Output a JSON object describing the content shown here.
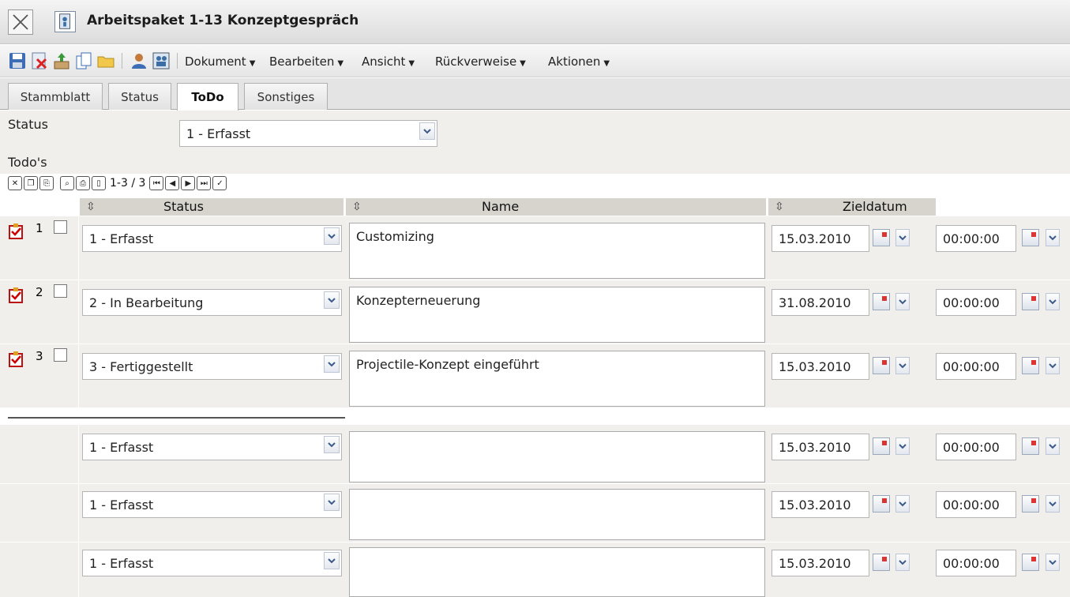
{
  "window": {
    "title": "Arbeitspaket 1-13 Konzeptgespräch"
  },
  "toolbar": {
    "icons": [
      "save-icon",
      "delete-icon",
      "export-icon",
      "copy-icon",
      "folder-icon",
      "user-icon",
      "contacts-icon"
    ],
    "menus": [
      {
        "label": "Dokument"
      },
      {
        "label": "Bearbeiten"
      },
      {
        "label": "Ansicht"
      },
      {
        "label": "Rückverweise"
      },
      {
        "label": "Aktionen"
      }
    ]
  },
  "tabs": [
    {
      "label": "Stammblatt",
      "active": false
    },
    {
      "label": "Status",
      "active": false
    },
    {
      "label": "ToDo",
      "active": true
    },
    {
      "label": "Sonstiges",
      "active": false
    }
  ],
  "form": {
    "status_label": "Status",
    "status_value": "1 - Erfasst",
    "todos_label": "Todo's"
  },
  "grid": {
    "pager": "1-3 / 3",
    "columns": {
      "status": "Status",
      "name": "Name",
      "zieldatum": "Zieldatum"
    },
    "rows": [
      {
        "num": "1",
        "status": "1 - Erfasst",
        "name": "Customizing",
        "date": "15.03.2010",
        "time": "00:00:00"
      },
      {
        "num": "2",
        "status": "2 - In Bearbeitung",
        "name": "Konzepterneuerung",
        "date": "31.08.2010",
        "time": "00:00:00"
      },
      {
        "num": "3",
        "status": "3 - Fertiggestellt",
        "name": "Projectile-Konzept eingeführt",
        "date": "15.03.2010",
        "time": "00:00:00"
      }
    ],
    "new_rows": [
      {
        "status": "1 - Erfasst",
        "name": "",
        "date": "15.03.2010",
        "time": "00:00:00"
      },
      {
        "status": "1 - Erfasst",
        "name": "",
        "date": "15.03.2010",
        "time": "00:00:00"
      },
      {
        "status": "1 - Erfasst",
        "name": "",
        "date": "15.03.2010",
        "time": "00:00:00"
      }
    ]
  }
}
